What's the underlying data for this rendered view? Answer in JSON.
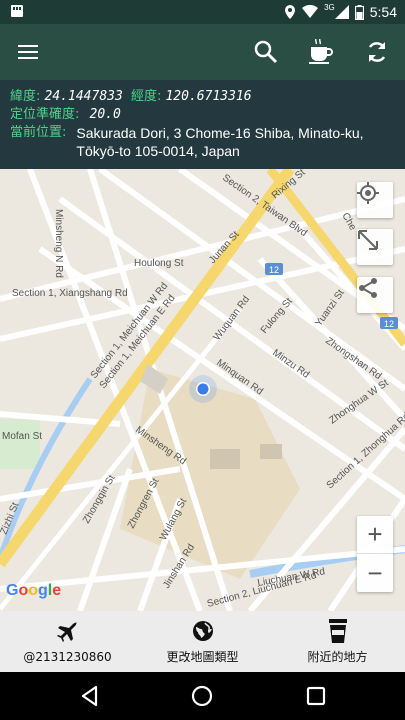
{
  "status_bar": {
    "time": "5:54",
    "signal_label": "3G",
    "icons": [
      "notification-icon",
      "location-icon",
      "wifi-icon",
      "cellular-icon",
      "battery-icon"
    ]
  },
  "app_bar": {
    "icons": [
      "menu-icon",
      "search-icon",
      "coffee-icon",
      "refresh-icon"
    ],
    "color": "#2a4d44"
  },
  "info": {
    "lat_label": "緯度:",
    "lat_value": "24.1447833",
    "lng_label": "經度:",
    "lng_value": "120.6713316",
    "accuracy_label": "定位準確度:",
    "accuracy_value": "20.0",
    "address_label": "當前位置:",
    "address_value": "Sakurada Dori, 3 Chome-16 Shiba, Minato-ku, Tōkyō-to 105-0014, Japan",
    "label_color": "#4fd38b"
  },
  "map": {
    "labels": {
      "minsheng_n": "Minsheng N Rd",
      "houlong": "Houlong St",
      "xiangshang": "Section 1, Xiangshang Rd",
      "meichuan_w": "Section 1, Meichuan W Rd",
      "meichuan_e": "Section 1, Meichuan E Rd",
      "wuquan": "Wuquan Rd",
      "minquan": "Minquan Rd",
      "fulong": "Fulong St",
      "minzu": "Minzu Rd",
      "yuanzi": "Yuanzi St",
      "zhongshan": "Zhongshan Rd",
      "zhonghua_w": "Zhonghua W St",
      "zhonghua_rd": "Section 1, Zhonghua Rd",
      "taiwan_blvd": "Section 2, Taiwan Blvd",
      "rixing": "Rixing St",
      "junan": "Junan St",
      "mofan": "Mofan St",
      "minsheng_rd": "Minsheng Rd",
      "zhongqin": "Zhongqin St",
      "zhongren": "Zhongren St",
      "wulang": "Wulang St",
      "jinshan": "Jinshan Rd",
      "zizhi": "Zizhi St",
      "liuchuan_w": "Liuchuan W Rd",
      "liuchuan_e": "Section 2, Liuchuan E Rd",
      "che": "Che",
      "shield_12a": "12",
      "shield_12b": "12"
    },
    "google_logo": "Google",
    "zoom_in": "+",
    "zoom_out": "−"
  },
  "bottom_bar": {
    "items": [
      {
        "icon": "airplane-icon",
        "label": "@2131230860"
      },
      {
        "icon": "globe-icon",
        "label": "更改地圖類型"
      },
      {
        "icon": "cup-icon",
        "label": "附近的地方"
      }
    ]
  },
  "nav_bar": {
    "icons": [
      "back-icon",
      "home-icon",
      "recents-icon"
    ]
  }
}
